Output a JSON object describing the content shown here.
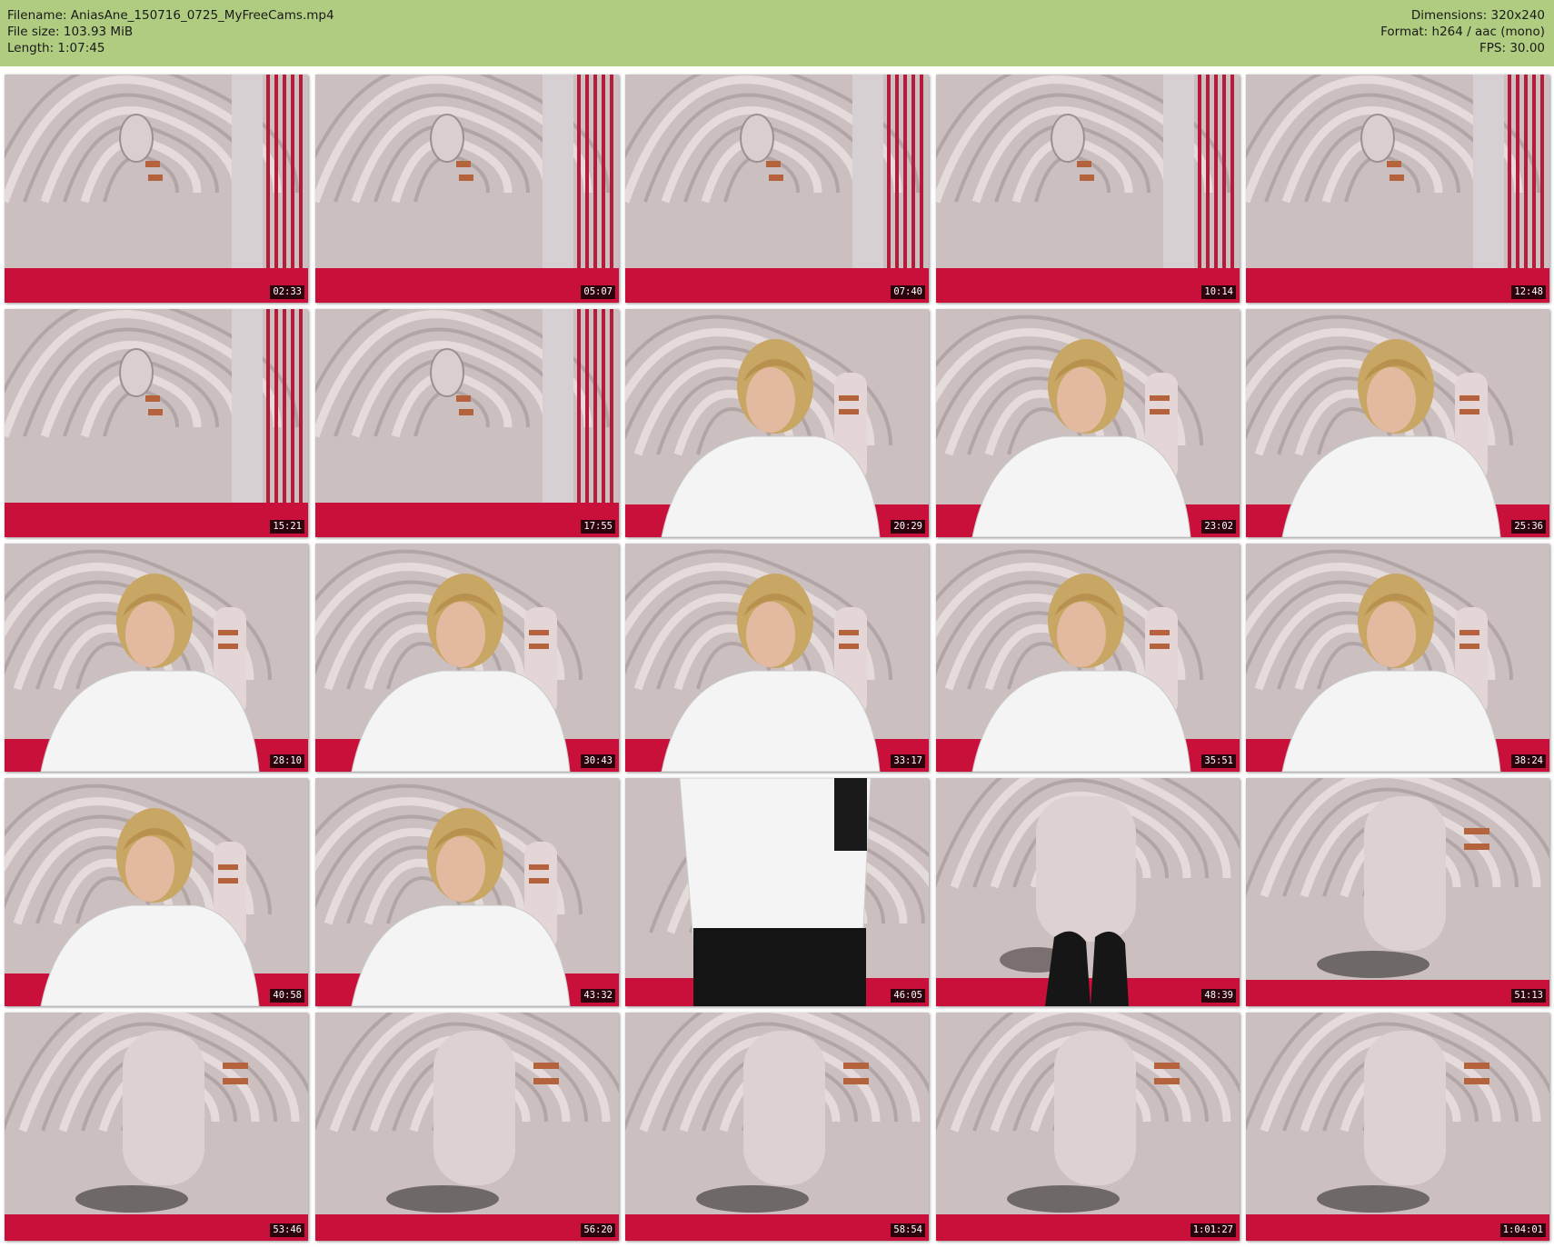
{
  "header": {
    "filename": "Filename: AniasAne_150716_0725_MyFreeCams.mp4",
    "filesize": "File size: 103.93 MiB",
    "length": "Length: 1:07:45",
    "dimensions": "Dimensions: 320x240",
    "format": "Format: h264 / aac (mono)",
    "fps": "FPS: 30.00"
  },
  "colors": {
    "header_bg": "#b0cc80",
    "wall": "#cbbfc0",
    "floor": "#c8103a",
    "curtain": "#b51c3c",
    "shirt": "#f4f4f4",
    "hair": "#c8a664"
  },
  "thumbnails": [
    {
      "time": "02:33",
      "scene": "empty-room"
    },
    {
      "time": "05:07",
      "scene": "empty-room"
    },
    {
      "time": "07:40",
      "scene": "empty-room"
    },
    {
      "time": "10:14",
      "scene": "empty-room"
    },
    {
      "time": "12:48",
      "scene": "empty-room"
    },
    {
      "time": "15:21",
      "scene": "empty-room"
    },
    {
      "time": "17:55",
      "scene": "empty-room"
    },
    {
      "time": "20:29",
      "scene": "woman-seated"
    },
    {
      "time": "23:02",
      "scene": "woman-seated"
    },
    {
      "time": "25:36",
      "scene": "woman-seated"
    },
    {
      "time": "28:10",
      "scene": "woman-seated"
    },
    {
      "time": "30:43",
      "scene": "woman-seated"
    },
    {
      "time": "33:17",
      "scene": "woman-seated"
    },
    {
      "time": "35:51",
      "scene": "woman-seated"
    },
    {
      "time": "38:24",
      "scene": "woman-seated"
    },
    {
      "time": "40:58",
      "scene": "woman-seated"
    },
    {
      "time": "43:32",
      "scene": "woman-seated"
    },
    {
      "time": "46:05",
      "scene": "woman-standing"
    },
    {
      "time": "48:39",
      "scene": "woman-legs"
    },
    {
      "time": "51:13",
      "scene": "wall-pillow"
    },
    {
      "time": "53:46",
      "scene": "wall-pillow"
    },
    {
      "time": "56:20",
      "scene": "wall-pillow"
    },
    {
      "time": "58:54",
      "scene": "wall-pillow"
    },
    {
      "time": "1:01:27",
      "scene": "wall-pillow"
    },
    {
      "time": "1:04:01",
      "scene": "wall-pillow"
    }
  ]
}
